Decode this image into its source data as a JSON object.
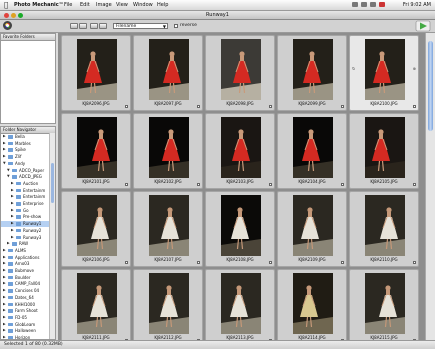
{
  "menubar": {
    "items": [
      "Photo Mechanic™",
      "File",
      "Edit",
      "Image",
      "View",
      "Window",
      "Help"
    ],
    "clock": "Fri 9:02 AM"
  },
  "window": {
    "title": "Runway1"
  },
  "toolbar": {
    "sort_value": "Filename",
    "reverse_label": "reverse"
  },
  "favorites_panel": {
    "title": "Favorite Folders"
  },
  "navigator": {
    "title": "Folder Navigator",
    "items": [
      {
        "label": "Bella",
        "depth": 0,
        "open": false
      },
      {
        "label": "Marbles",
        "depth": 0,
        "open": false
      },
      {
        "label": "Spike",
        "depth": 0,
        "open": false
      },
      {
        "label": "Zlif",
        "depth": 0,
        "open": false
      },
      {
        "label": "Andy",
        "depth": 0,
        "open": true
      },
      {
        "label": "ADCO_Paper",
        "depth": 1,
        "open": true
      },
      {
        "label": "ADCD_JPEG",
        "depth": 1,
        "open": true
      },
      {
        "label": "Auction",
        "depth": 2,
        "open": false
      },
      {
        "label": "Entertainm",
        "depth": 2,
        "open": false
      },
      {
        "label": "Entertainm",
        "depth": 2,
        "open": false
      },
      {
        "label": "Enterprise",
        "depth": 2,
        "open": false
      },
      {
        "label": "Go",
        "depth": 2,
        "open": false
      },
      {
        "label": "Pre-show",
        "depth": 2,
        "open": false
      },
      {
        "label": "Runway1",
        "depth": 2,
        "open": false,
        "selected": true
      },
      {
        "label": "Runway2",
        "depth": 2,
        "open": false
      },
      {
        "label": "Runway3",
        "depth": 2,
        "open": false
      },
      {
        "label": "RAW",
        "depth": 1,
        "open": false
      },
      {
        "label": "ALMS",
        "depth": 0,
        "open": false
      },
      {
        "label": "Applications",
        "depth": 0,
        "open": false
      },
      {
        "label": "Arno03",
        "depth": 0,
        "open": false
      },
      {
        "label": "Bubmove",
        "depth": 0,
        "open": false
      },
      {
        "label": "Boulder",
        "depth": 0,
        "open": false
      },
      {
        "label": "CAMP_Fall04",
        "depth": 0,
        "open": false
      },
      {
        "label": "Concises 04",
        "depth": 0,
        "open": false
      },
      {
        "label": "Dates_64",
        "depth": 0,
        "open": false
      },
      {
        "label": "KHHI1000",
        "depth": 0,
        "open": false
      },
      {
        "label": "Farm Shoot",
        "depth": 0,
        "open": false
      },
      {
        "label": "FD-05",
        "depth": 0,
        "open": false
      },
      {
        "label": "GlobLeam",
        "depth": 0,
        "open": false
      },
      {
        "label": "Halloween",
        "depth": 0,
        "open": false
      },
      {
        "label": "Horizon",
        "depth": 0,
        "open": false
      }
    ]
  },
  "grid": {
    "cells": [
      {
        "name": "KJ8A2096.JPG",
        "num": "",
        "scene": "red-runway",
        "land": false
      },
      {
        "name": "KJ8A2097.JPG",
        "num": "",
        "scene": "red-runway",
        "land": false
      },
      {
        "name": "KJ8A2098.JPG",
        "num": "",
        "scene": "red-wide",
        "land": false
      },
      {
        "name": "KJ8A2099.JPG",
        "num": "",
        "scene": "red-runway",
        "land": false
      },
      {
        "name": "KJ8A2100.JPG",
        "num": "",
        "scene": "red-runway",
        "land": false
      },
      {
        "name": "KJ8A2101.JPG",
        "num": "",
        "scene": "red-stage",
        "land": false
      },
      {
        "name": "KJ8A2102.JPG",
        "num": "",
        "scene": "red-stage",
        "land": false
      },
      {
        "name": "KJ8A2103.JPG",
        "num": "",
        "scene": "red-close",
        "land": false
      },
      {
        "name": "KJ8A2104.JPG",
        "num": "",
        "scene": "red-stage",
        "land": false
      },
      {
        "name": "KJ8A2105.JPG",
        "num": "",
        "scene": "red-close",
        "land": false
      },
      {
        "name": "KJ8A2106.JPG",
        "num": "",
        "scene": "white-runway",
        "land": false
      },
      {
        "name": "KJ8A2107.JPG",
        "num": "",
        "scene": "white-runway",
        "land": false
      },
      {
        "name": "KJ8A2108.JPG",
        "num": "",
        "scene": "white-dark",
        "land": false
      },
      {
        "name": "KJ8A2109.JPG",
        "num": "",
        "scene": "white-runway",
        "land": false
      },
      {
        "name": "KJ8A2110.JPG",
        "num": "",
        "scene": "white-runway",
        "land": false
      },
      {
        "name": "KJ8A2111.JPG",
        "num": "",
        "scene": "white-runway",
        "land": false
      },
      {
        "name": "KJ8A2112.JPG",
        "num": "",
        "scene": "white-runway",
        "land": false
      },
      {
        "name": "KJ8A2113.JPG",
        "num": "",
        "scene": "white-runway",
        "land": false
      },
      {
        "name": "KJ8A2114.JPG",
        "num": "",
        "scene": "gold-runway",
        "land": false
      },
      {
        "name": "KJ8A2115.JPG",
        "num": "",
        "scene": "white-runway",
        "land": false
      }
    ]
  },
  "status": {
    "text": "Selected 1 of 80 (0.32MB)"
  },
  "colors": {
    "accent": "#6f9fd8",
    "grid_bg": "#8e8e8e",
    "cell_bg": "#cfcfcf",
    "dress_red": "#d42a22",
    "dress_white": "#e6e2d8"
  }
}
